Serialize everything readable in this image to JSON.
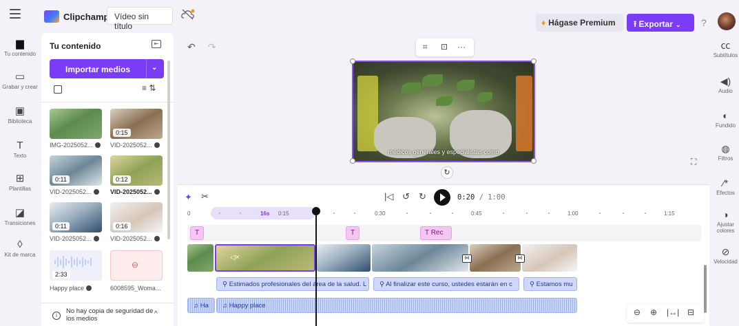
{
  "header": {
    "app_name": "Clipchamp",
    "video_title": "Vídeo sin título",
    "premium_label": "Hágase Premium",
    "export_label": "Exportar",
    "help_label": "?"
  },
  "left_rail": [
    {
      "label": "Tu contenido",
      "icon": "folder-icon"
    },
    {
      "label": "Grabar y crear",
      "icon": "camera-icon"
    },
    {
      "label": "Biblioteca",
      "icon": "library-icon"
    },
    {
      "label": "Texto",
      "icon": "text-icon"
    },
    {
      "label": "Plantillas",
      "icon": "templates-icon"
    },
    {
      "label": "Transiciones",
      "icon": "transitions-icon"
    },
    {
      "label": "Kit de marca",
      "icon": "brand-kit-icon"
    }
  ],
  "panel": {
    "title": "Tu contenido",
    "import_label": "Importar medios",
    "media": [
      {
        "name": "IMG-2025052...",
        "duration": ""
      },
      {
        "name": "VID-2025052...",
        "duration": "0:15"
      },
      {
        "name": "VID-2025052...",
        "duration": "0:11"
      },
      {
        "name": "VID-2025052...",
        "duration": "0:12"
      },
      {
        "name": "VID-2025052...",
        "duration": "0:11"
      },
      {
        "name": "VID-2025052...",
        "duration": "0:16"
      },
      {
        "name": "Happy place",
        "duration": "2:33"
      },
      {
        "name": "6008595_Woma...",
        "duration": ""
      }
    ],
    "backup_text": "No hay copia de seguridad de los medios"
  },
  "preview": {
    "subtitle": "médicos generales y especialistas como"
  },
  "right_rail": [
    {
      "label": "Subtítulos",
      "icon": "cc-icon"
    },
    {
      "label": "Audio",
      "icon": "speaker-icon"
    },
    {
      "label": "Fundido",
      "icon": "fade-icon"
    },
    {
      "label": "Filtros",
      "icon": "filters-icon"
    },
    {
      "label": "Efectos",
      "icon": "effects-icon"
    },
    {
      "label": "Ajustar colores",
      "icon": "adjust-colors-icon"
    },
    {
      "label": "Velocidad",
      "icon": "speed-icon"
    }
  ],
  "timeline": {
    "current_time": "0:20",
    "total_time": "/ 1:00",
    "ruler": [
      "0",
      "16s",
      "0:15",
      "0:30",
      "0:45",
      "1:00",
      "1:15"
    ],
    "text_clips": [
      "T",
      "T",
      "T  Rec"
    ],
    "subtitle_clips": [
      "Estimados profesionales del área de la salud. L",
      "Al finalizar este curso, ustedes estarán en c",
      "Estamos mu"
    ],
    "audio_clips": [
      "Ha",
      "Happy place"
    ]
  },
  "colors": {
    "accent": "#7a3cf5",
    "premium_gem": "#f29a18",
    "text_clip": "#f4c6f2",
    "subtitle_clip": "#cfd8fb"
  }
}
